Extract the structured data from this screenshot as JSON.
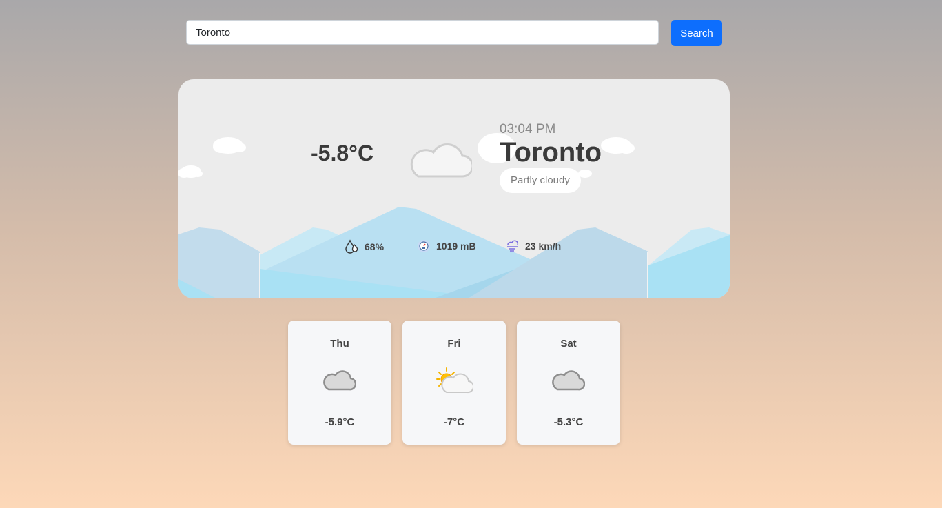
{
  "search": {
    "value": "Toronto",
    "button_label": "Search"
  },
  "current": {
    "temperature": "-5.8°C",
    "time": "03:04 PM",
    "city": "Toronto",
    "condition": "Partly cloudy",
    "icon": "moon-cloud-icon",
    "humidity": "68%",
    "pressure": "1019 mB",
    "wind": "23 km/h"
  },
  "forecast": [
    {
      "day": "Thu",
      "icon": "cloud-icon",
      "temp": "-5.9°C"
    },
    {
      "day": "Fri",
      "icon": "sun-cloud-icon",
      "temp": "-7°C"
    },
    {
      "day": "Sat",
      "icon": "cloud-icon",
      "temp": "-5.3°C"
    }
  ],
  "colors": {
    "accent": "#0d6efd",
    "card": "#ececec",
    "mountain_light": "#a9e1f4",
    "mountain_mid": "#c2dff0"
  }
}
